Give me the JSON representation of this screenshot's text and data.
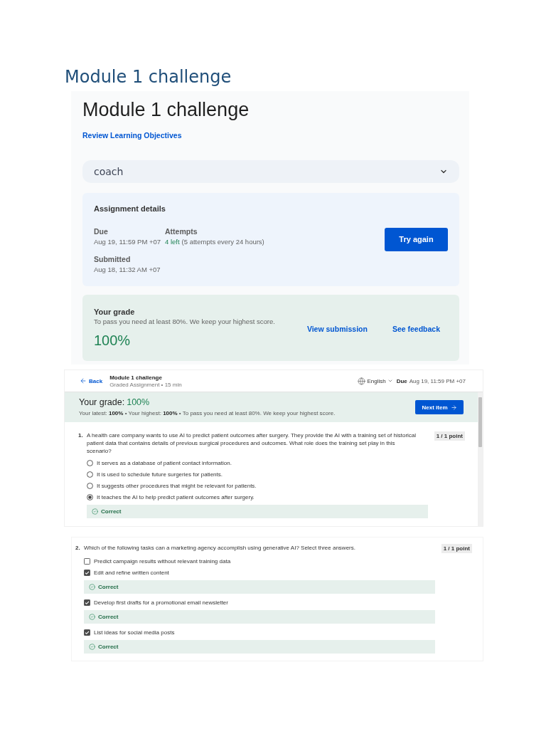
{
  "document": {
    "heading": "Module 1 challenge"
  },
  "overview_screenshot": {
    "title": "Module 1 challenge",
    "objectives_link": "Review Learning Objectives",
    "coach": {
      "label": "coach",
      "expanded": false
    },
    "assignment_details": {
      "heading": "Assignment details",
      "due": {
        "label": "Due",
        "value": "Aug 19, 11:59 PM +07"
      },
      "attempts": {
        "label": "Attempts",
        "remaining": "4 left",
        "note": "(5 attempts every 24 hours)"
      },
      "submitted": {
        "label": "Submitted",
        "value": "Aug 18, 11:32 AM +07"
      },
      "button": "Try again"
    },
    "grade": {
      "heading": "Your grade",
      "note": "To pass you need at least 80%. We keep your highest score.",
      "score": "100%",
      "links": [
        "View submission",
        "See feedback"
      ]
    }
  },
  "quiz_screenshot": {
    "header": {
      "back": "Back",
      "title": "Module 1 challenge",
      "subtitle": "Graded Assignment • 15 min",
      "language": "English",
      "due_label": "Due",
      "due_value": "Aug 19, 11:59 PM +07"
    },
    "grade_banner": {
      "label": "Your grade:",
      "score": "100%",
      "summary": "Your latest: **100%** • Your highest: **100%** • To pass you need at least 80%. We keep your highest score.",
      "button": "Next item"
    },
    "questions": [
      {
        "number": "1.",
        "kind": "single",
        "text": "A health care company wants to use AI to predict patient outcomes after surgery. They provide the AI with a training set of historical patient data that contains details of previous surgical procedures and outcomes. What role does the training set play in this scenario?",
        "points": "1 / 1 point",
        "options": [
          {
            "text": "It serves as a database of patient contact information.",
            "selected": false
          },
          {
            "text": "It is used to schedule future surgeries for patients.",
            "selected": false
          },
          {
            "text": "It suggests other procedures that might be relevant for patients.",
            "selected": false
          },
          {
            "text": "It teaches the AI to help predict patient outcomes after surgery.",
            "selected": true,
            "feedback": "Correct"
          }
        ]
      }
    ]
  },
  "question_screenshot": {
    "questions": [
      {
        "number": "2.",
        "kind": "multiple",
        "text": "Which of the following tasks can a marketing agency accomplish using generative AI? Select three answers.",
        "points": "1 / 1 point",
        "options": [
          {
            "text": "Predict campaign results without relevant training data",
            "checked": false
          },
          {
            "text": "Edit and refine written content",
            "checked": true,
            "feedback": "Correct"
          },
          {
            "text": "Develop first drafts for a promotional email newsletter",
            "checked": true,
            "feedback": "Correct"
          },
          {
            "text": "List ideas for social media posts",
            "checked": true,
            "feedback": "Correct"
          }
        ]
      }
    ]
  }
}
